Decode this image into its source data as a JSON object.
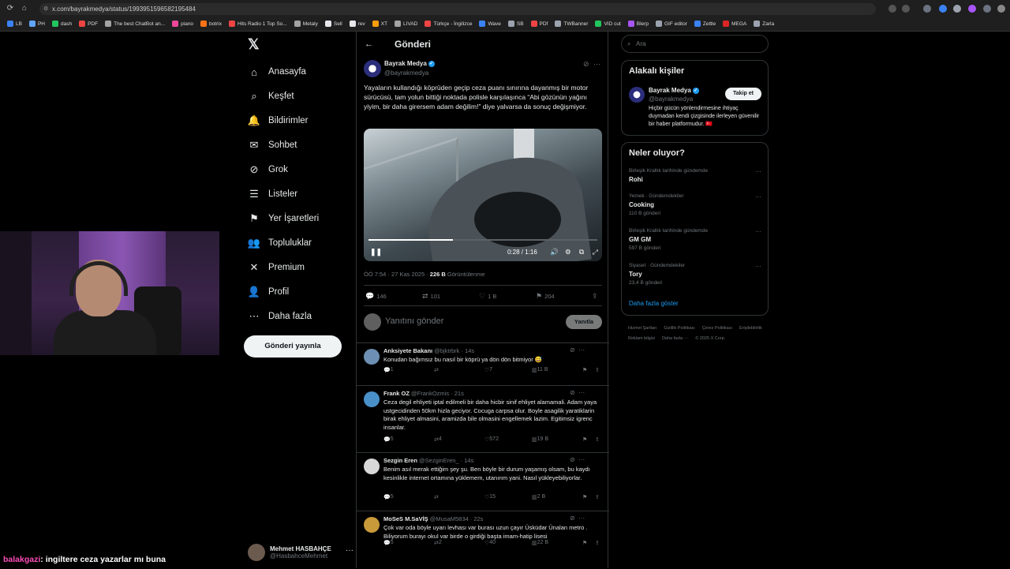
{
  "browser": {
    "url": "x.com/bayrakmedya/status/1993951596582195484",
    "bookmarks": [
      {
        "label": "LB",
        "color": "#3b82f6"
      },
      {
        "label": "PH",
        "color": "#60a5fa"
      },
      {
        "label": "dash",
        "color": "#22c55e"
      },
      {
        "label": "PDF",
        "color": "#ef4444"
      },
      {
        "label": "The best ChatBot an...",
        "color": "#a3a3a3"
      },
      {
        "label": "piano",
        "color": "#ec4899"
      },
      {
        "label": "botrix",
        "color": "#f97316"
      },
      {
        "label": "Hits Radio 1 Top So...",
        "color": "#ef4444"
      },
      {
        "label": "Metaly",
        "color": "#a3a3a3"
      },
      {
        "label": "Sell",
        "color": "#e5e7eb"
      },
      {
        "label": "rev",
        "color": "#e5e7eb"
      },
      {
        "label": "XT",
        "color": "#f59e0b"
      },
      {
        "label": "LIVAD",
        "color": "#a3a3a3"
      },
      {
        "label": "Türkçe - İngilizce",
        "color": "#ef4444"
      },
      {
        "label": "Wave",
        "color": "#3b82f6"
      },
      {
        "label": "SB",
        "color": "#9ca3af"
      },
      {
        "label": "PDf",
        "color": "#ef4444"
      },
      {
        "label": "TWBanner",
        "color": "#9ca3af"
      },
      {
        "label": "VID cut",
        "color": "#22c55e"
      },
      {
        "label": "Blerp",
        "color": "#a855f7"
      },
      {
        "label": "GIF editor",
        "color": "#9ca3af"
      },
      {
        "label": "Zettle",
        "color": "#3b82f6"
      },
      {
        "label": "MEGA",
        "color": "#dc2626"
      },
      {
        "label": "Zarla",
        "color": "#9ca3af"
      }
    ]
  },
  "nav": {
    "items": [
      {
        "label": "Anasayfa",
        "icon": "home-icon",
        "glyph": "⌂"
      },
      {
        "label": "Keşfet",
        "icon": "search-icon",
        "glyph": "⌕"
      },
      {
        "label": "Bildirimler",
        "icon": "bell-icon",
        "glyph": "🔔"
      },
      {
        "label": "Sohbet",
        "icon": "mail-icon",
        "glyph": "✉"
      },
      {
        "label": "Grok",
        "icon": "grok-icon",
        "glyph": "⊘"
      },
      {
        "label": "Listeler",
        "icon": "list-icon",
        "glyph": "☰"
      },
      {
        "label": "Yer İşaretleri",
        "icon": "bookmark-icon",
        "glyph": "⚑"
      },
      {
        "label": "Topluluklar",
        "icon": "communities-icon",
        "glyph": "👥"
      },
      {
        "label": "Premium",
        "icon": "x-logo-icon",
        "glyph": "✕"
      },
      {
        "label": "Profil",
        "icon": "profile-icon",
        "glyph": "👤"
      },
      {
        "label": "Daha fazla",
        "icon": "more-circle-icon",
        "glyph": "⋯"
      }
    ],
    "post_button": "Gönderi yayınla",
    "account": {
      "name": "Mehmet HASBAHÇE",
      "handle": "@HasbahceMehmet"
    }
  },
  "chat_overlay": {
    "user": "balakgazi",
    "message": ": ingiltere ceza yazarlar mı buna"
  },
  "main": {
    "title": "Gönderi",
    "post": {
      "author": "Bayrak Medya",
      "handle": "@bayrakmedya",
      "text": "Yayaların kullandığı köprüden geçip ceza puanı sınırına dayanmış bir motor sürücüsü, tam yolun bittiği noktada polisle karşılaşınca “Abi gözünün yağını yiyim, bir daha girersem adam değilim!” diye yalvarsa da sonuç değişmiyor.",
      "video_time": "0:28 / 1:16",
      "video_progress": 0.37,
      "meta_time": "ÖÖ 7:54 · 27 Kas 2025 · ",
      "views": "226 B",
      "views_label": " Görüntülenme",
      "stats": {
        "replies": "146",
        "reposts": "101",
        "likes": "1 B",
        "bookmarks": "204"
      }
    },
    "reply_placeholder": "Yanıtını gönder",
    "reply_button": "Yanıtla",
    "replies": [
      {
        "name": "Anksiyete Bakanı",
        "handle": "@bjktrbrk · 14s",
        "text": "Konudan bağımsız bu nasıl bir köprü ya dön dön bitmiyor 😅",
        "replies": "1",
        "reposts": "",
        "likes": "7",
        "views": "11 B",
        "avatar": "#6d8fb3"
      },
      {
        "name": "Frank OZ",
        "handle": "@FrankOzmis · 21s",
        "text": "Ceza degil ehliyeti iptal edilmeli bir daha hicbir sinif ehliyet alamamali. Adam yaya ustgecidinden 50km hizla geciyor. Cocuga carpsa olur. Boyle asagilik yaratiklarin birak ehliyet almasini, aramizda bile olmasini engellemek lazim. Egitimsiz igrenc insanlar.",
        "replies": "5",
        "reposts": "4",
        "likes": "572",
        "views": "19 B",
        "avatar": "#4a90c8"
      },
      {
        "name": "Sezgin Eren",
        "handle": "@SezginEren_ · 14s",
        "text": "Benim asıl merak ettiğim şey şu. Ben böyle bir durum yaşamış olsam, bu kaydı kesinlikle internet ortamına yüklemem, utanırım yani. Nasıl yükleyebiliyorlar.",
        "replies": "5",
        "reposts": "",
        "likes": "15",
        "views": "2 B",
        "avatar": "#d8d8d8"
      },
      {
        "name": "MoSeS M.SaVİŞ",
        "handle": "@MusaM5834 · 22s",
        "text": "Çok var oda böyle uyarı levhası var burası uzun çayır Üsküdar Ünalan metro . Biliyorum burayı okul var birde o girdiği başta imam-hatip lisesi",
        "replies": "5",
        "reposts": "2",
        "likes": "40",
        "views": "22 B",
        "avatar": "#c89a3a"
      }
    ]
  },
  "right": {
    "search_placeholder": "Ara",
    "people_title": "Alakalı kişiler",
    "person": {
      "name": "Bayrak Medya",
      "handle": "@bayrakmedya",
      "bio": "Hiçbir gücün yönlendirmesine ihtiyaç duymadan kendi çizgisinde ilerleyen güvenilir bir haber platformudur. 🇹🇷"
    },
    "follow_button": "Takip et",
    "trends_title": "Neler oluyor?",
    "trends": [
      {
        "context": "Birleşik Krallık tarihinde gündemde",
        "topic": "Rohi",
        "posts": ""
      },
      {
        "context": "Yemek · Gündemdekiler",
        "topic": "Cooking",
        "posts": "110 B gönderi"
      },
      {
        "context": "Birleşik Krallık tarihinde gündemde",
        "topic": "GM GM",
        "posts": "597 B gönderi"
      },
      {
        "context": "Siyaset · Gündemdekiler",
        "topic": "Tory",
        "posts": "23,4 B gönderi"
      }
    ],
    "show_more": "Daha fazla göster",
    "footer": [
      "Hizmet Şartları",
      "Gizlilik Politikası",
      "Çerez Politikası",
      "Erişilebilirlik",
      "Reklam bilgisi",
      "Daha fazla ···",
      "© 2025 X Corp."
    ]
  }
}
